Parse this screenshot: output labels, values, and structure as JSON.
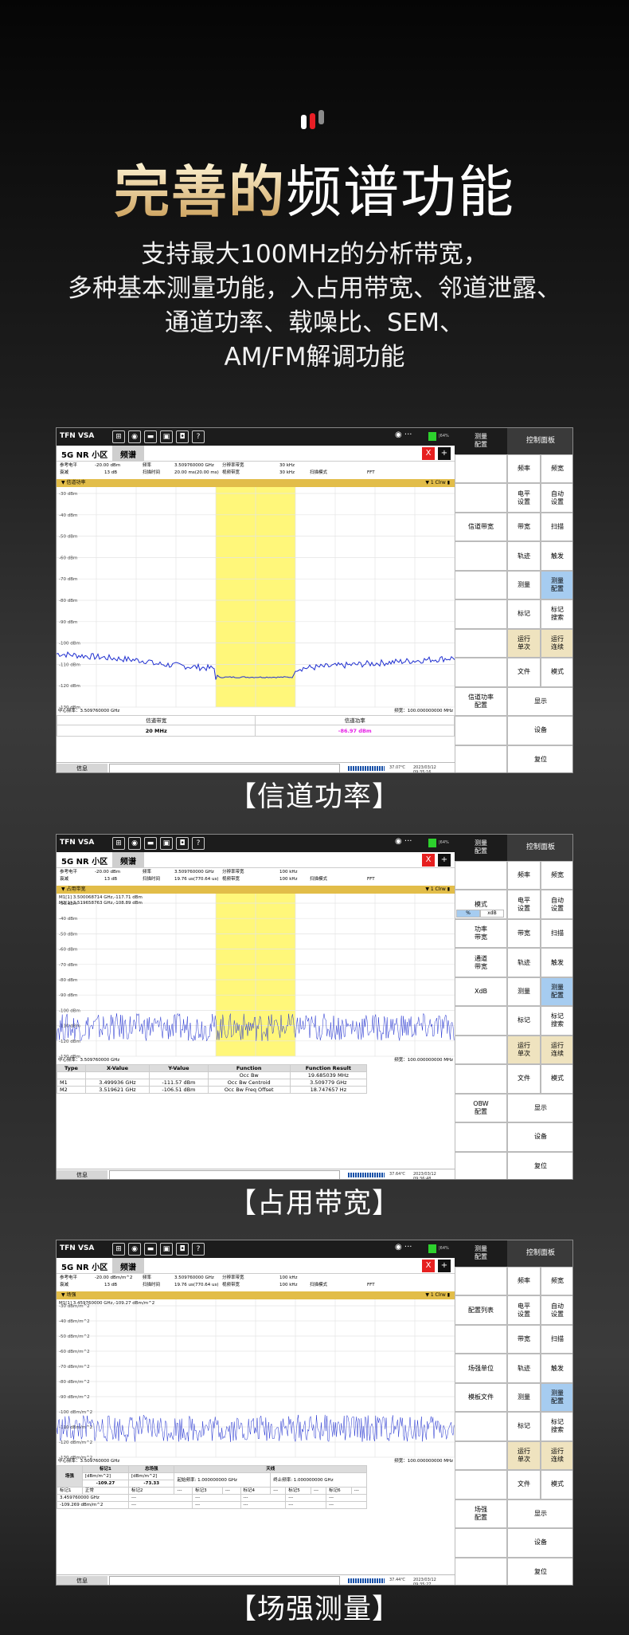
{
  "header": {
    "title_highlight": "完善的",
    "title_rest": "频谱功能",
    "desc_lines": [
      "支持最大100MHz的分析带宽，",
      "多种基本测量功能，入占用带宽、邻道泄露、",
      "通道功率、载噪比、SEM、",
      "AM/FM解调功能"
    ]
  },
  "colors": {
    "gold": "#c99b53",
    "trace": "#1f2fd0",
    "highlight": "#fff77a",
    "marker": "#e620e6"
  },
  "shots": [
    {
      "app": "TFN VSA",
      "tab_cell": "5G NR 小区",
      "tab_spec": "频谱",
      "close": "X",
      "plus": "+",
      "params": {
        "ref_label": "参考电平",
        "ref_val": "-20.00 dBm",
        "freq_label": "频率",
        "freq_val": "3.509760000 GHz",
        "rbw_label": "分辨率带宽",
        "rbw_val": "30 kHz",
        "att_label": "衰减",
        "att_val": "13 dB",
        "sweep_label": "扫描时间",
        "sweep_val": "20.00 ms(20.00 ms)",
        "vbw_label": "视频带宽",
        "vbw_val": "30 kHz",
        "mode_label": "扫描模式",
        "mode_val": "FFT"
      },
      "trace_title": "▼ 信道功率",
      "trace_flag": "▼ 1 Clrw ▮",
      "y_ticks": [
        "-30 dBm",
        "-40 dBm",
        "-50 dBm",
        "-60 dBm",
        "-70 dBm",
        "-80 dBm",
        "-90 dBm",
        "-100 dBm",
        "-110 dBm",
        "-120 dBm",
        "-130 dBm"
      ],
      "center": "中心频率：3.509760000 GHz",
      "span": "频宽：100.000000000 MHz",
      "result_hdr": [
        "信道带宽",
        "信道功率"
      ],
      "result_val": [
        "20 MHz",
        "-86.97 dBm"
      ],
      "status_info": "信息",
      "temp": "37.07℃",
      "ts": "2023/03/12 09:35:16",
      "side_hd": [
        "测量\n配置",
        "控制面板"
      ],
      "left_col": [
        "",
        "",
        "信道带宽",
        "",
        "",
        "",
        "",
        "",
        "信道功率\n配置",
        "",
        ""
      ],
      "right_a": [
        "频率",
        "电平\n设置",
        "带宽",
        "轨迹",
        "测量",
        "标记",
        "运行\n单次",
        "文件",
        "显示",
        "设备",
        "复位"
      ],
      "right_b": [
        "频宽",
        "自动\n设置",
        "扫描",
        "触发",
        "测量\n配置",
        "标记\n搜索",
        "运行\n连续",
        "模式"
      ],
      "caption": "【信道功率】"
    },
    {
      "app": "TFN VSA",
      "tab_cell": "5G NR 小区",
      "tab_spec": "频谱",
      "close": "X",
      "plus": "+",
      "params": {
        "ref_label": "参考电平",
        "ref_val": "-20.00 dBm",
        "freq_label": "频率",
        "freq_val": "3.509760000 GHz",
        "rbw_label": "分辨率带宽",
        "rbw_val": "100 kHz",
        "att_label": "衰减",
        "att_val": "13 dB",
        "sweep_label": "扫描时间",
        "sweep_val": "19.76 us(770.64 us)",
        "vbw_label": "视频带宽",
        "vbw_val": "100 kHz",
        "mode_label": "扫描模式",
        "mode_val": "FFT"
      },
      "trace_title": "▼ 占用带宽",
      "trace_flag": "▼ 1 Clrw ▮",
      "marker_lines": [
        "M1[1]   3.500068714 GHz,-117.71 dBm",
        "M2[1]   3.519658763 GHz,-108.89 dBm"
      ],
      "y_ticks": [
        "-30 dBm",
        "-40 dBm",
        "-50 dBm",
        "-60 dBm",
        "-70 dBm",
        "-80 dBm",
        "-90 dBm",
        "-100 dBm",
        "-110 dBm",
        "-120 dBm",
        "-130 dBm"
      ],
      "center": "中心频率：3.509760000 GHz",
      "span": "频宽：100.000000000 MHz",
      "table_hdr": [
        "Type",
        "X-Value",
        "Y-Value",
        "Function",
        "Function Result"
      ],
      "table_rows": [
        [
          "",
          "",
          "",
          "Occ Bw",
          "19.685039 MHz"
        ],
        [
          "M1",
          "3.499936 GHz",
          "-111.57 dBm",
          "Occ Bw Centroid",
          "3.509779 GHz"
        ],
        [
          "M2",
          "3.519621 GHz",
          "-106.51 dBm",
          "Occ Bw Freq Offset",
          "18.747657 Hz"
        ]
      ],
      "status_info": "信息",
      "temp": "37.64℃",
      "ts": "2023/03/12 09:36:48",
      "side_hd": [
        "测量\n配置",
        "控制面板"
      ],
      "left_col": [
        "",
        "模式",
        "功率\n带宽",
        "通道\n带宽",
        "XdB",
        "",
        "",
        "",
        "OBW\n配置",
        "",
        ""
      ],
      "mode_toggle": [
        "%",
        "xdB"
      ],
      "right_a": [
        "频率",
        "电平\n设置",
        "带宽",
        "轨迹",
        "测量",
        "标记",
        "运行\n单次",
        "文件",
        "显示",
        "设备",
        "复位"
      ],
      "right_b": [
        "频宽",
        "自动\n设置",
        "扫描",
        "触发",
        "测量\n配置",
        "标记\n搜索",
        "运行\n连续",
        "模式"
      ],
      "caption": "【占用带宽】"
    },
    {
      "app": "TFN VSA",
      "tab_cell": "5G NR 小区",
      "tab_spec": "频谱",
      "close": "X",
      "plus": "+",
      "params": {
        "ref_label": "参考电平",
        "ref_val": "-20.00 dBm/m^2",
        "freq_label": "频率",
        "freq_val": "3.509760000 GHz",
        "rbw_label": "分辨率带宽",
        "rbw_val": "100 kHz",
        "att_label": "衰减",
        "att_val": "13 dB",
        "sweep_label": "扫描时间",
        "sweep_val": "19.76 us(770.64 us)",
        "vbw_label": "视频带宽",
        "vbw_val": "100 kHz",
        "mode_label": "扫描模式",
        "mode_val": "FFT"
      },
      "trace_title": "▼ 场强",
      "trace_flag": "▼ 1 Clrw ▮",
      "marker_lines": [
        "M1[1]   3.459760000 GHz,-109.27 dBm/m^2"
      ],
      "y_ticks": [
        "-30 dBm/m^2",
        "-40 dBm/m^2",
        "-50 dBm/m^2",
        "-60 dBm/m^2",
        "-70 dBm/m^2",
        "-80 dBm/m^2",
        "-90 dBm/m^2",
        "-100 dBm/m^2",
        "-110 dBm/m^2",
        "-120 dBm/m^2",
        "-130 dBm/m^2"
      ],
      "center": "中心频率：3.509760000 GHz",
      "span": "频宽：100.000000000 MHz",
      "fs_table": {
        "hdr": [
          "场强",
          "标记1",
          "总场强",
          "天线"
        ],
        "sub": [
          "[dBm/m^2]",
          "[dBm/m^2]"
        ],
        "vals": [
          "-109.27",
          "-73.33"
        ],
        "ant": [
          "起始频率: 1.000000000 GHz",
          "终止频率: 1.000000000 GHz"
        ],
        "row2": [
          "标记1",
          "正常",
          "标记2",
          "---",
          "标记3",
          "---",
          "标记4",
          "---",
          "标记5",
          "---",
          "标记6",
          "---"
        ],
        "row3": [
          "3.459760000 GHz",
          "---",
          "---",
          "---",
          "---",
          "---"
        ],
        "row4": [
          "-109.269 dBm/m^2",
          "---",
          "---",
          "---",
          "---",
          "---"
        ]
      },
      "status_info": "信息",
      "temp": "37.44℃",
      "ts": "2023/03/12 09:35:27",
      "side_hd": [
        "测量\n配置",
        "控制面板"
      ],
      "left_col": [
        "",
        "配置列表",
        "",
        "场强单位",
        "模板文件",
        "",
        "",
        "",
        "场强\n配置",
        "",
        ""
      ],
      "right_a": [
        "频率",
        "电平\n设置",
        "带宽",
        "轨迹",
        "测量",
        "标记",
        "运行\n单次",
        "文件",
        "显示",
        "设备",
        "复位"
      ],
      "right_b": [
        "频宽",
        "自动\n设置",
        "扫描",
        "触发",
        "测量\n配置",
        "标记\n搜索",
        "运行\n连续",
        "模式"
      ],
      "caption": "【场强测量】"
    }
  ]
}
